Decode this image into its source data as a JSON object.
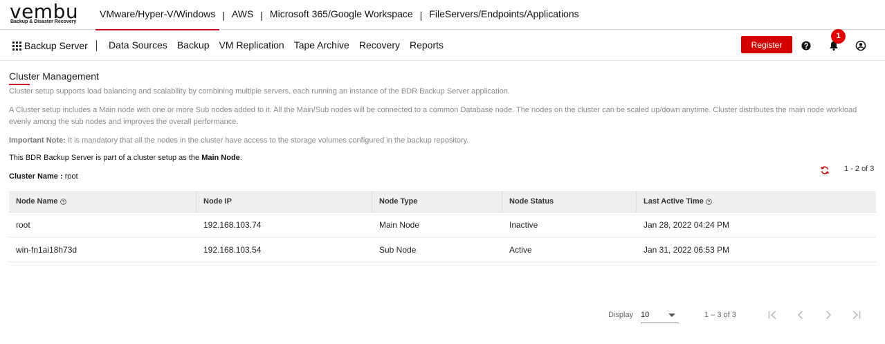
{
  "brand": {
    "name": "vembu",
    "tagline": "Backup & Disaster Recovery"
  },
  "product_tabs": [
    {
      "label": "VMware/Hyper-V/Windows",
      "active": true
    },
    {
      "label": "AWS",
      "active": false
    },
    {
      "label": "Microsoft 365/Google Workspace",
      "active": false
    },
    {
      "label": "FileServers/Endpoints/Applications",
      "active": false
    }
  ],
  "product_separator": "|",
  "nav": {
    "app_label": "Backup Server",
    "items": [
      "Data Sources",
      "Backup",
      "VM Replication",
      "Tape Archive",
      "Recovery",
      "Reports"
    ],
    "register_label": "Register",
    "notification_count": "1",
    "accent_color": "#d40000"
  },
  "page": {
    "title": "Cluster Management",
    "description_1": "Cluster setup supports load balancing and scalability by combining multiple servers, each running an instance of the BDR Backup Server application.",
    "description_2": "A Cluster setup includes a Main node with one or more Sub nodes added to it. All the Main/Sub nodes will be connected to a common Database node. The nodes on the cluster can be scaled up/down anytime. Cluster distributes the main node workload evenly among the sub nodes and improves the overall performance.",
    "note_label": "Important Note:",
    "note_text": " It is mandatory that all the nodes in the cluster have access to the storage volumes configured in the backup repository.",
    "membership_prefix": "This BDR Backup Server is part of a cluster setup as the ",
    "membership_role": "Main Node",
    "membership_suffix": ".",
    "cluster_name_label": "Cluster Name : ",
    "cluster_name_value": "root",
    "count_label": "1 - 2 of 3"
  },
  "table": {
    "headers": [
      "Node Name",
      "Node IP",
      "Node Type",
      "Node Status",
      "Last Active Time"
    ],
    "rows": [
      [
        "root",
        "192.168.103.74",
        "Main Node",
        "Inactive",
        "Jan 28, 2022 04:24 PM"
      ],
      [
        "win-fn1ai18h73d",
        "192.168.103.54",
        "Sub Node",
        "Active",
        "Jan 31, 2022 06:53 PM"
      ]
    ]
  },
  "pagination": {
    "display_label": "Display",
    "page_size": "10",
    "range_label": "1 – 3 of 3"
  }
}
